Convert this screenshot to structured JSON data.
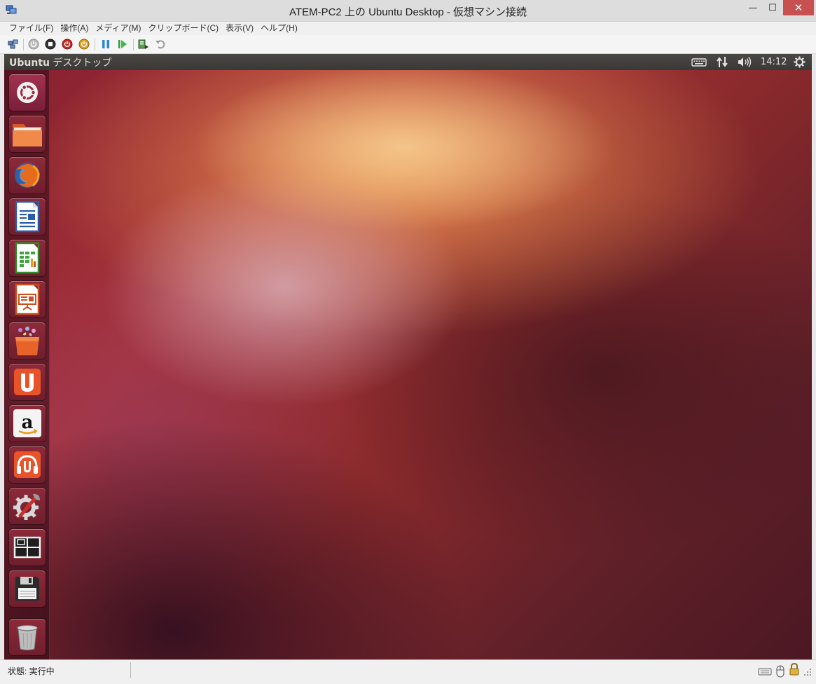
{
  "window": {
    "title": "ATEM-PC2 上の Ubuntu Desktop  - 仮想マシン接続",
    "controls": {
      "minimize": "—",
      "maximize": "☐",
      "close": "✕"
    }
  },
  "menubar": {
    "items": [
      "ファイル(F)",
      "操作(A)",
      "メディア(M)",
      "クリップボード(C)",
      "表示(V)",
      "ヘルプ(H)"
    ]
  },
  "toolbar": {
    "icons": [
      "ctrl-alt-del-icon",
      "start-icon",
      "turn-off-icon",
      "shutdown-icon",
      "save-icon",
      "pause-icon",
      "reset-icon",
      "snapshot-icon",
      "revert-icon"
    ]
  },
  "ubuntu": {
    "panel_title_bold": "Ubuntu",
    "panel_title_rest": " デスクトップ",
    "clock": "14:12",
    "indicators": [
      "keyboard-icon",
      "network-icon",
      "volume-icon",
      "session-gear-icon"
    ],
    "launcher": [
      "dash-home-icon",
      "files-icon",
      "firefox-icon",
      "writer-icon",
      "calc-icon",
      "impress-icon",
      "software-center-icon",
      "ubuntu-one-icon",
      "amazon-icon",
      "ubuntu-one-music-icon",
      "system-settings-icon",
      "workspace-switcher-icon",
      "floppy-drive-icon",
      "trash-icon"
    ]
  },
  "statusbar": {
    "text": "状態: 実行中"
  },
  "colors": {
    "panel": "#3c3b37",
    "desktop_warm": "#e96d3a",
    "desktop_dark": "#5e1f28",
    "close_button": "#c75050",
    "ubuntu_orange": "#dd4814"
  }
}
